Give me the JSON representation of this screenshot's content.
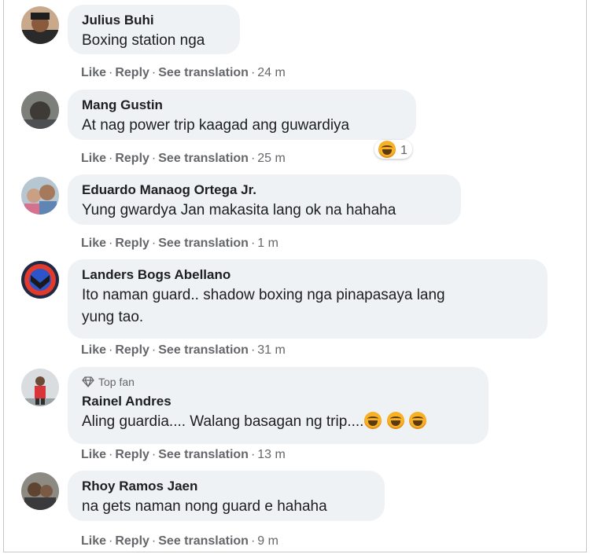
{
  "comments": [
    {
      "author": "Julius Buhi",
      "text": "Boxing station nga",
      "actions": {
        "like": "Like",
        "reply": "Reply",
        "translate": "See translation",
        "time": "24 m"
      }
    },
    {
      "author": "Mang Gustin",
      "text": "At nag power trip kaagad ang guwardiya",
      "reaction": {
        "icon": "haha-emoji-icon",
        "count": "1"
      },
      "actions": {
        "like": "Like",
        "reply": "Reply",
        "translate": "See translation",
        "time": "25 m"
      }
    },
    {
      "author": "Eduardo Manaog Ortega Jr.",
      "text": "Yung gwardya Jan makasita lang ok na hahaha",
      "actions": {
        "like": "Like",
        "reply": "Reply",
        "translate": "See translation",
        "time": "1 m"
      }
    },
    {
      "author": "Landers Bogs Abellano",
      "text_line1": "Ito naman guard.. shadow boxing nga pinapasaya lang",
      "text_line2": "yung tao.",
      "actions": {
        "like": "Like",
        "reply": "Reply",
        "translate": "See translation",
        "time": "31 m"
      }
    },
    {
      "badge": "Top fan",
      "author": "Rainel Andres",
      "text": "Aling guardia.... Walang basagan ng trip....",
      "emojis": [
        "haha-emoji-icon",
        "haha-emoji-icon",
        "haha-emoji-icon"
      ],
      "actions": {
        "like": "Like",
        "reply": "Reply",
        "translate": "See translation",
        "time": "13 m"
      }
    },
    {
      "author": "Rhoy Ramos Jaen",
      "text": "na gets naman nong guard e hahaha",
      "actions": {
        "like": "Like",
        "reply": "Reply",
        "translate": "See translation",
        "time": "9 m"
      }
    }
  ],
  "separator": "·",
  "colors": {
    "bubble": "#eff2f5",
    "text": "#1c1e21",
    "meta": "#65676b"
  }
}
